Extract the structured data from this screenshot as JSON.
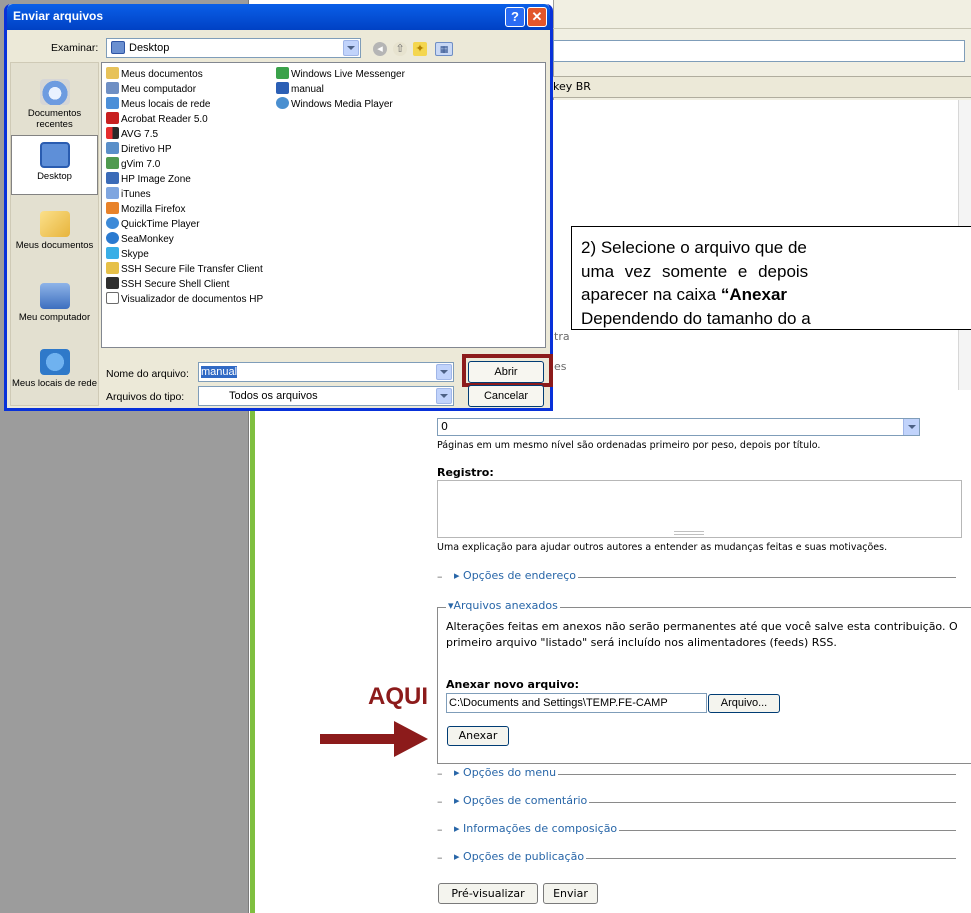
{
  "dialog": {
    "title": "Enviar arquivos",
    "help_btn": "?",
    "close_btn": "✕",
    "look_in_label": "Examinar:",
    "look_in_value": "Desktop",
    "places": [
      "Documentos recentes",
      "Desktop",
      "Meus documentos",
      "Meu computador",
      "Meus locais de rede"
    ],
    "files_col1": [
      "Meus documentos",
      "Meu computador",
      "Meus locais de rede",
      "Acrobat Reader 5.0",
      "AVG 7.5",
      "Diretivo HP",
      "gVim 7.0",
      "HP Image Zone",
      "iTunes",
      "Mozilla Firefox",
      "QuickTime Player",
      "SeaMonkey",
      "Skype",
      "SSH Secure File Transfer Client",
      "SSH Secure Shell Client",
      "Visualizador de documentos HP"
    ],
    "files_col2": [
      "Windows Live Messenger",
      "manual",
      "Windows Media Player"
    ],
    "filename_label": "Nome do arquivo:",
    "filename_value": "manual",
    "filetype_label": "Arquivos do tipo:",
    "filetype_value": "Todos os arquivos",
    "open_label": "Abrir",
    "cancel_label": "Cancelar"
  },
  "browser": {
    "tab_text": "key BR",
    "peek_1": "tra",
    "peek_2": "es"
  },
  "callout": {
    "line1": "2) Selecione o arquivo que de",
    "line2": "uma vez somente e depois",
    "line3_pre": "aparecer na caixa ",
    "line3_bold": "“Anexar",
    "line4": "Dependendo do tamanho do a"
  },
  "form": {
    "weight_value": "0",
    "weight_help": "Páginas em um mesmo nível são ordenadas primeiro por peso, depois por título.",
    "registro_label": "Registro:",
    "registro_help": "Uma explicação para ajudar outros autores a entender as mudanças feitas e suas motivações.",
    "address_options": "Opções de endereço",
    "attachments_legend": "Arquivos anexados",
    "attachments_text": "Alterações feitas em anexos não serão permanentes até que você salve esta contribuição. O primeiro arquivo \"listado\" será incluído nos alimentadores (feeds) RSS.",
    "new_file_label": "Anexar novo arquivo:",
    "file_path": "C:\\Documents and Settings\\TEMP.FE-CAMP",
    "browse_label": "Arquivo...",
    "attach_label": "Anexar",
    "menu_options": "Opções do menu",
    "comment_options": "Opções de comentário",
    "composition_info": "Informações de composição",
    "publish_options": "Opções de publicação",
    "preview_label": "Pré-visualizar",
    "submit_label": "Enviar"
  },
  "annotation": {
    "aqui": "AQUI"
  },
  "colors": {
    "highlight_red": "#8c1b1b",
    "xp_blue": "#0a5fe8",
    "link_blue": "#2866a8",
    "accent_green": "#7fbf3f"
  }
}
